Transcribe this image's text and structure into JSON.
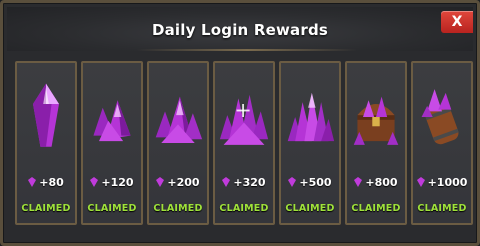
{
  "dialog": {
    "title": "Daily Login Rewards",
    "close_label": "X"
  },
  "colors": {
    "claimed": "#9fe23a",
    "gem": "#c03bdc",
    "close": "#d83a30",
    "frame": "#6b5c43"
  },
  "days": [
    {
      "icon": "single-crystal-icon",
      "amount": "+80",
      "status": "CLAIMED"
    },
    {
      "icon": "small-crystal-pile-icon",
      "amount": "+120",
      "status": "CLAIMED"
    },
    {
      "icon": "crystal-pile-icon",
      "amount": "+200",
      "status": "CLAIMED"
    },
    {
      "icon": "large-crystal-pile-icon",
      "amount": "+320",
      "status": "CLAIMED"
    },
    {
      "icon": "crystal-cluster-icon",
      "amount": "+500",
      "status": "CLAIMED"
    },
    {
      "icon": "crystal-chest-icon",
      "amount": "+800",
      "status": "CLAIMED"
    },
    {
      "icon": "crystal-barrel-icon",
      "amount": "+1000",
      "status": "CLAIMED"
    }
  ]
}
